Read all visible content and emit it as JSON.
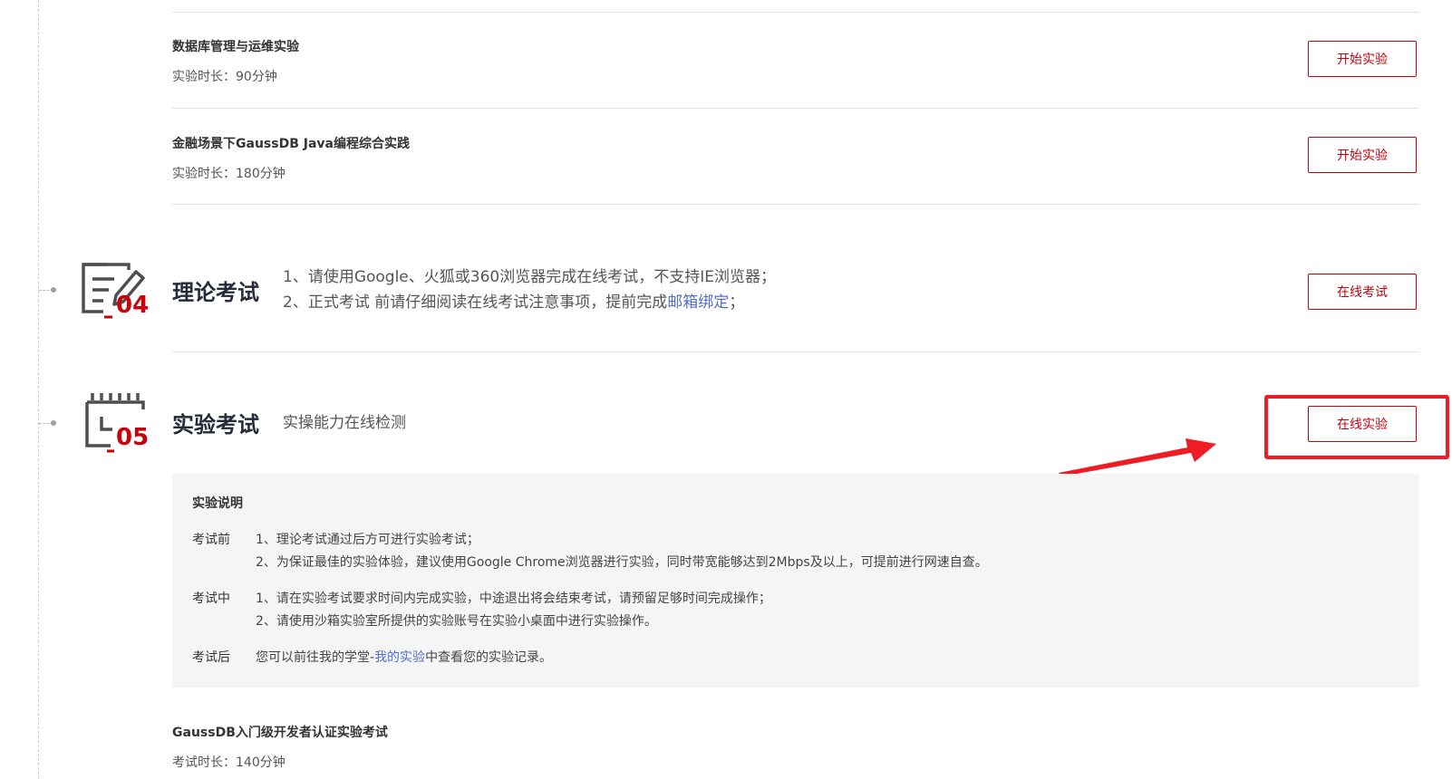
{
  "courses": [
    {
      "title": "数据库管理与运维实验",
      "duration": "实验时长：90分钟",
      "button": "开始实验"
    },
    {
      "title": "金融场景下GaussDB Java编程综合实践",
      "duration": "实验时长：180分钟",
      "button": "开始实验"
    }
  ],
  "theory": {
    "number": "04",
    "title": "理论考试",
    "line1": "1、请使用Google、火狐或360浏览器完成在线考试，不支持IE浏览器；",
    "line2_prefix": "2、正式考试 前请仔细阅读在线考试注意事项，提前完成",
    "line2_link": "邮箱绑定",
    "line2_suffix": "；",
    "button": "在线考试"
  },
  "lab": {
    "number": "05",
    "title": "实验考试",
    "subtitle": "实操能力在线检测",
    "button": "在线实验"
  },
  "notes": {
    "heading": "实验说明",
    "before_label": "考试前",
    "before_1": "1、理论考试通过后方可进行实验考试；",
    "before_2": "2、为保证最佳的实验体验，建议使用Google Chrome浏览器进行实验，同时带宽能够达到2Mbps及以上，可提前进行网速自查。",
    "during_label": "考试中",
    "during_1": "1、请在实验考试要求时间内完成实验，中途退出将会结束考试，请预留足够时间完成操作；",
    "during_2": "2、请使用沙箱实验室所提供的实验账号在实验小桌面中进行实验操作。",
    "after_label": "考试后",
    "after_prefix": "您可以前往我的学堂-",
    "after_link": "我的实验",
    "after_suffix": "中查看您的实验记录。"
  },
  "lab_course": {
    "title": "GaussDB入门级开发者认证实验考试",
    "duration": "考试时长：140分钟"
  },
  "colors": {
    "accent_red": "#c7000b",
    "annotation_red": "#ee1c24",
    "link_blue": "#526ecc",
    "icon_gray": "#4e4e4e"
  },
  "icons": [
    "exam-edit-icon",
    "lab-flask-icon",
    "red-arrow-annotation"
  ]
}
